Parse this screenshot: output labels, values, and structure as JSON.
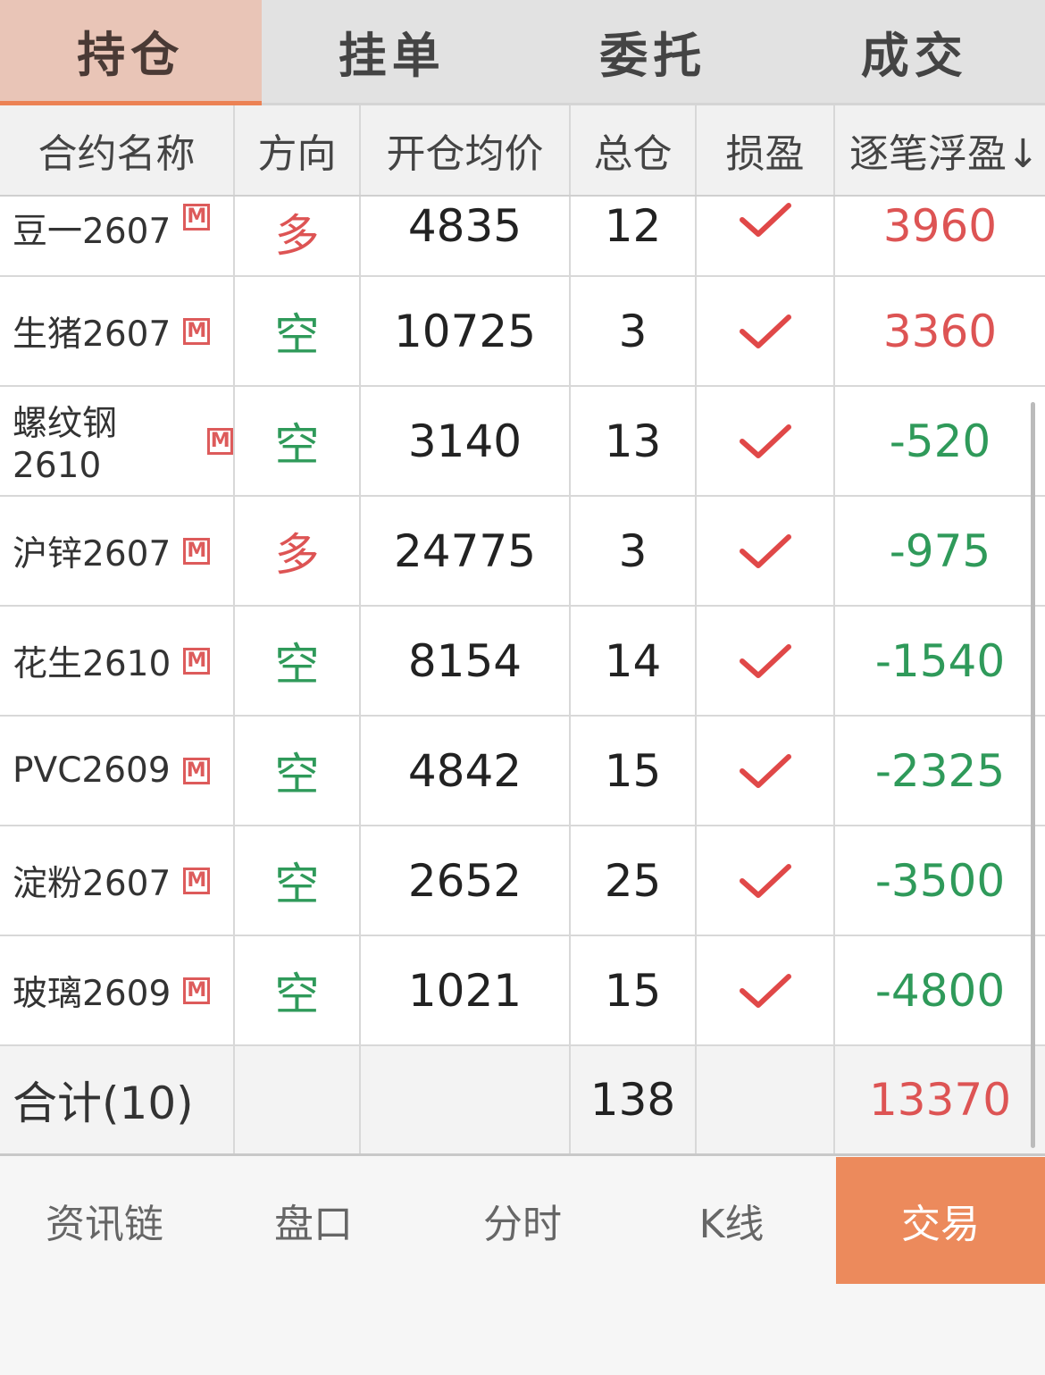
{
  "tabs": [
    {
      "label": "持仓",
      "active": true
    },
    {
      "label": "挂单",
      "active": false
    },
    {
      "label": "委托",
      "active": false
    },
    {
      "label": "成交",
      "active": false
    }
  ],
  "table": {
    "headers": [
      "合约名称",
      "方向",
      "开仓均价",
      "总仓",
      "损盈",
      "逐笔浮盈↓"
    ],
    "badge": "M",
    "rows": [
      {
        "name": "豆一2607",
        "direction": "多",
        "avg_price": "4835",
        "total": "12",
        "pl": "3960"
      },
      {
        "name": "生猪2607",
        "direction": "空",
        "avg_price": "10725",
        "total": "3",
        "pl": "3360"
      },
      {
        "name": "螺纹钢2610",
        "direction": "空",
        "avg_price": "3140",
        "total": "13",
        "pl": "-520"
      },
      {
        "name": "沪锌2607",
        "direction": "多",
        "avg_price": "24775",
        "total": "3",
        "pl": "-975"
      },
      {
        "name": "花生2610",
        "direction": "空",
        "avg_price": "8154",
        "total": "14",
        "pl": "-1540"
      },
      {
        "name": "PVC2609",
        "direction": "空",
        "avg_price": "4842",
        "total": "15",
        "pl": "-2325"
      },
      {
        "name": "淀粉2607",
        "direction": "空",
        "avg_price": "2652",
        "total": "25",
        "pl": "-3500"
      },
      {
        "name": "玻璃2609",
        "direction": "空",
        "avg_price": "1021",
        "total": "15",
        "pl": "-4800"
      }
    ],
    "total_row": {
      "label": "合计(10)",
      "total": "138",
      "pl": "13370"
    }
  },
  "bottom_nav": [
    {
      "label": "资讯链",
      "active": false
    },
    {
      "label": "盘口",
      "active": false
    },
    {
      "label": "分时",
      "active": false
    },
    {
      "label": "K线",
      "active": false
    },
    {
      "label": "交易",
      "active": true
    }
  ],
  "colors": {
    "accent": "#ec8a5c",
    "long": "#dd5454",
    "short": "#2f9a5a",
    "tab_active_bg": "#e9c5b7"
  }
}
